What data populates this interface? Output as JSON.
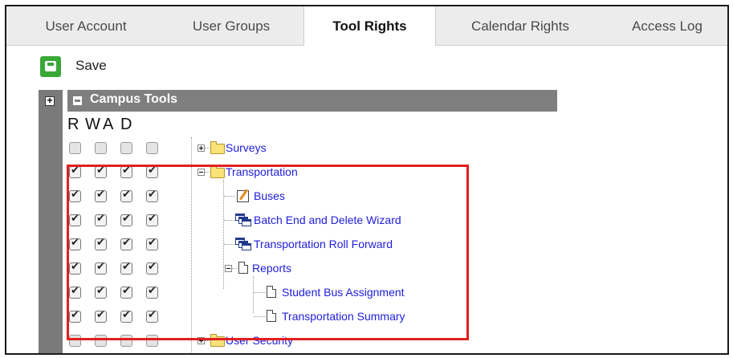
{
  "tabs": [
    {
      "label": "User Account",
      "active": false
    },
    {
      "label": "User Groups",
      "active": false
    },
    {
      "label": "Tool Rights",
      "active": true
    },
    {
      "label": "Calendar Rights",
      "active": false
    },
    {
      "label": "Access Log",
      "active": false
    }
  ],
  "toolbar": {
    "save_label": "Save",
    "save_icon": "floppy-disk-icon"
  },
  "section": {
    "title": "Campus Tools"
  },
  "columns": [
    "R",
    "W",
    "A",
    "D"
  ],
  "tree": [
    {
      "label": "Surveys",
      "icon": "folder-icon",
      "expander": "plus",
      "rights": {
        "R": false,
        "W": false,
        "A": false,
        "D": false
      }
    },
    {
      "label": "Transportation",
      "icon": "folder-icon",
      "expander": "minus",
      "rights": {
        "R": true,
        "W": true,
        "A": true,
        "D": true
      }
    },
    {
      "label": "Buses",
      "icon": "edit-icon",
      "rights": {
        "R": true,
        "W": true,
        "A": true,
        "D": true
      }
    },
    {
      "label": "Batch End and Delete Wizard",
      "icon": "wizard-icon",
      "rights": {
        "R": true,
        "W": true,
        "A": true,
        "D": true
      }
    },
    {
      "label": "Transportation Roll Forward",
      "icon": "wizard-icon",
      "rights": {
        "R": true,
        "W": true,
        "A": true,
        "D": true
      }
    },
    {
      "label": "Reports",
      "icon": "document-icon",
      "expander": "minus",
      "rights": {
        "R": true,
        "W": true,
        "A": true,
        "D": true
      }
    },
    {
      "label": "Student Bus Assignment",
      "icon": "document-icon",
      "rights": {
        "R": true,
        "W": true,
        "A": true,
        "D": true
      }
    },
    {
      "label": "Transportation Summary",
      "icon": "document-icon",
      "rights": {
        "R": true,
        "W": true,
        "A": true,
        "D": true
      }
    },
    {
      "label": "User Security",
      "icon": "folder-icon",
      "expander": "plus",
      "rights": {
        "R": false,
        "W": false,
        "A": false,
        "D": false
      }
    }
  ],
  "colors": {
    "highlight_border": "#e02020",
    "link": "#1d1ddc",
    "header_bar": "#7f7f7f",
    "save_button": "#3aa837"
  }
}
